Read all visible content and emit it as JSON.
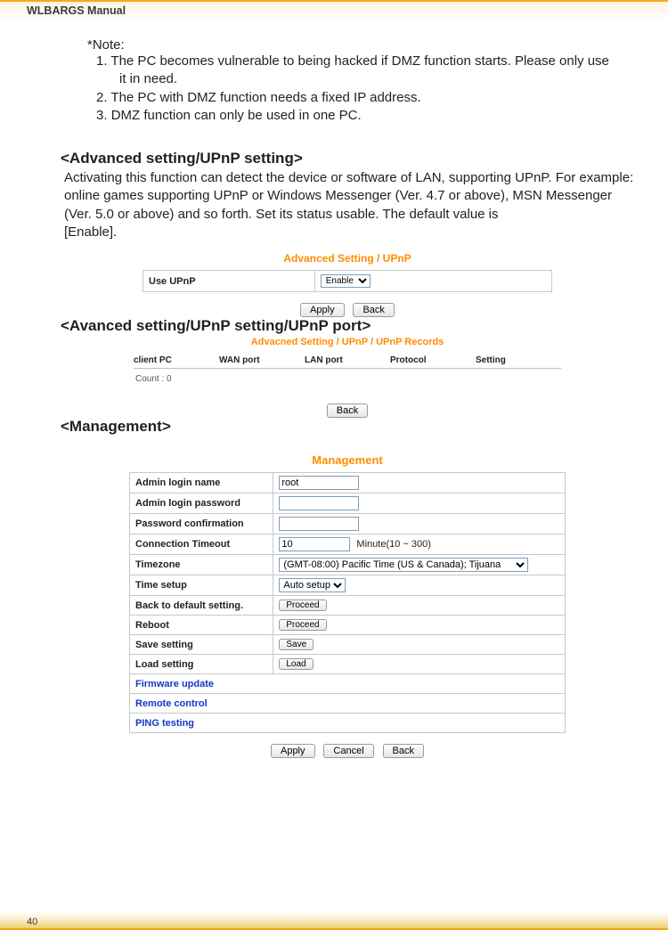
{
  "header": {
    "title": "WLBARGS Manual"
  },
  "note": {
    "title": "*Note:",
    "items": [
      {
        "num": "1.",
        "text": "The PC becomes vulnerable to being hacked if DMZ function starts.  Please only use",
        "cont": "it in need."
      },
      {
        "num": "2.",
        "text": "The PC with DMZ function needs a fixed IP address."
      },
      {
        "num": "3.",
        "text": "DMZ function can only be used in one PC."
      }
    ]
  },
  "sections": {
    "upnp_setting": {
      "title": "<Advanced setting/UPnP setting>",
      "body": "Activating this function can detect the device or software of LAN, supporting UPnP.  For example: online games supporting UPnP or Windows Messenger (Ver. 4.7 or above), MSN Messenger (Ver. 5.0 or above) and so forth.  Set its status usable.  The default value is",
      "body2": "[Enable].",
      "shot_title": "Advanced Setting / UPnP",
      "row_label": "Use UPnP",
      "select_value": "Enable",
      "btn_apply": "Apply",
      "btn_back": "Back"
    },
    "upnp_port": {
      "title": "<Avanced setting/UPnP setting/UPnP port>",
      "shot_title": "Advacned Setting / UPnP / UPnP Records",
      "headers": [
        "client PC",
        "WAN port",
        "LAN port",
        "Protocol",
        "Setting"
      ],
      "count_label": "Count :  0",
      "btn_back": "Back"
    },
    "management": {
      "title": "<Management>",
      "shot_title": "Management",
      "rows": {
        "admin_login_name": {
          "label": "Admin login name",
          "value": "root"
        },
        "admin_login_password": {
          "label": "Admin login password",
          "value": ""
        },
        "password_confirmation": {
          "label": "Password confirmation",
          "value": ""
        },
        "connection_timeout": {
          "label": "Connection Timeout",
          "value": "10",
          "hint": "Minute(10 ~ 300)"
        },
        "timezone": {
          "label": "Timezone",
          "value": "(GMT-08:00) Pacific Time (US & Canada); Tijuana"
        },
        "time_setup": {
          "label": "Time setup",
          "value": "Auto setup"
        },
        "back_default": {
          "label": "Back to default setting.",
          "btn": "Proceed"
        },
        "reboot": {
          "label": "Reboot",
          "btn": "Proceed"
        },
        "save_setting": {
          "label": "Save setting",
          "btn": "Save"
        },
        "load_setting": {
          "label": "Load setting",
          "btn": "Load"
        },
        "firmware_update": {
          "label": "Firmware update"
        },
        "remote_control": {
          "label": "Remote control"
        },
        "ping_testing": {
          "label": "PING testing"
        }
      },
      "btns": {
        "apply": "Apply",
        "cancel": "Cancel",
        "back": "Back"
      }
    }
  },
  "footer": {
    "page_number": "40"
  }
}
